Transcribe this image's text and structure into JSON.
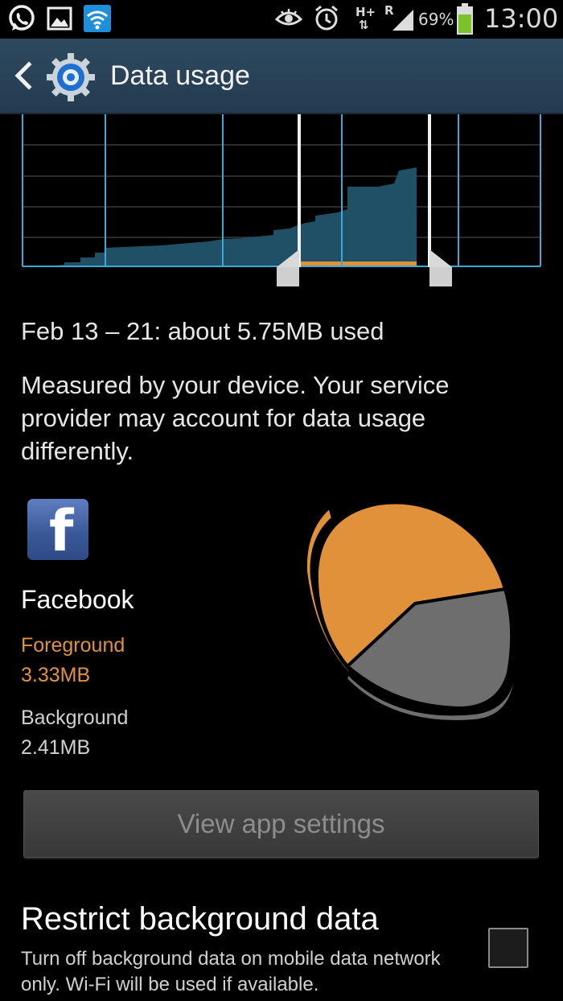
{
  "status_bar": {
    "battery": "69%",
    "time": "13:00",
    "network_type": "H+",
    "roaming": "R",
    "icons": [
      "whatsapp-icon",
      "gallery-icon",
      "wifi-icon",
      "eye-icon",
      "alarm-icon",
      "signal-icon",
      "battery-icon"
    ]
  },
  "action_bar": {
    "title": "Data usage",
    "icons": [
      "back-icon",
      "settings-gear-icon"
    ]
  },
  "usage": {
    "range_text": "Feb 13 – 21: about 5.75MB used",
    "note": "Measured by your device. Your service provider may account for data usage differently."
  },
  "app": {
    "name": "Facebook",
    "logo_letter": "f",
    "foreground_label": "Foreground",
    "foreground_value": "3.33MB",
    "background_label": "Background",
    "background_value": "2.41MB"
  },
  "colors": {
    "foreground": "#e2913b",
    "background": "#6e6e6e",
    "chart_fill": "#1f5066",
    "chart_grid": "#3aa9d6",
    "accent_bar": "#2e4a60"
  },
  "buttons": {
    "view_app_settings": "View app settings"
  },
  "restrict": {
    "title": "Restrict background data",
    "subtitle": "Turn off background data on mobile data network only. Wi-Fi will be used if available.",
    "checked": false
  }
}
